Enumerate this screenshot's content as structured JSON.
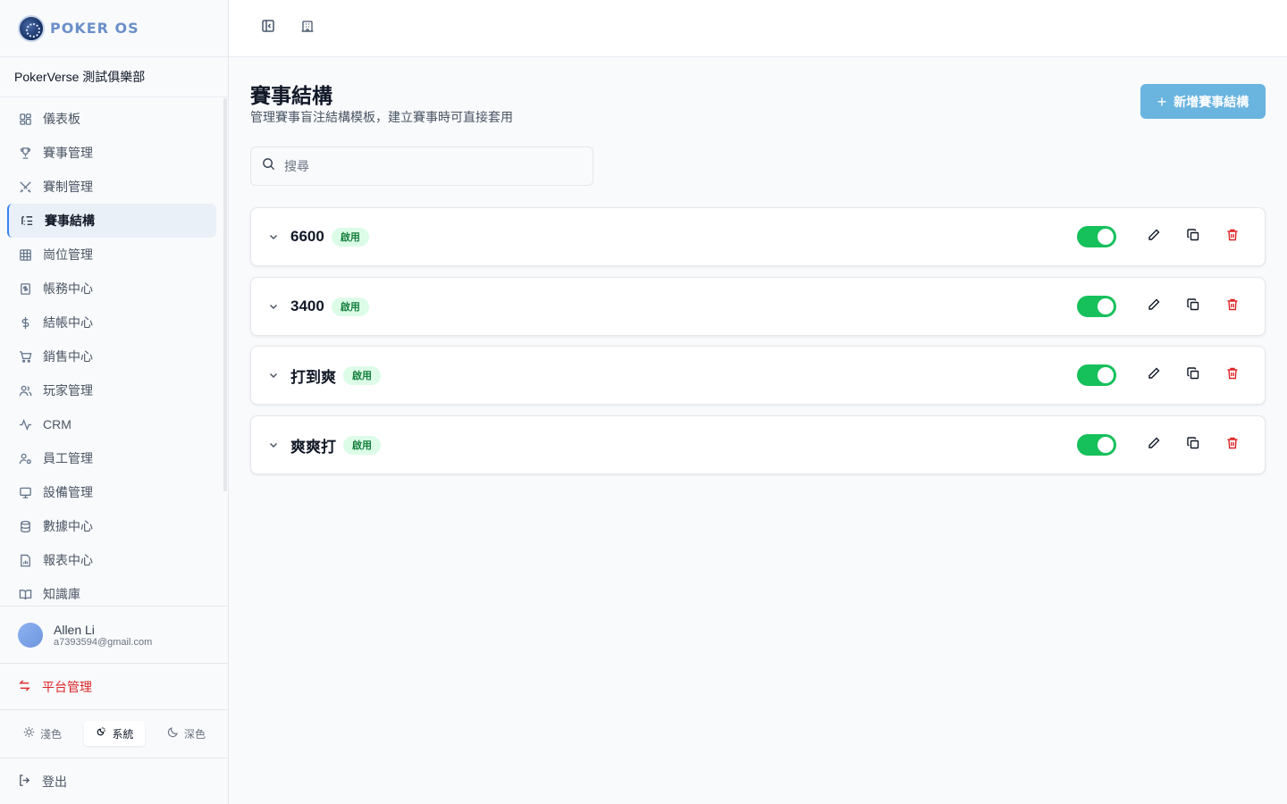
{
  "brand": {
    "name": "POKER OS"
  },
  "club": {
    "name": "PokerVerse 測試俱樂部"
  },
  "sidebar": {
    "items": [
      {
        "label": "儀表板",
        "icon": "dashboard-icon"
      },
      {
        "label": "賽事管理",
        "icon": "trophy-icon"
      },
      {
        "label": "賽制管理",
        "icon": "swords-icon"
      },
      {
        "label": "賽事結構",
        "icon": "list-tree-icon",
        "active": true
      },
      {
        "label": "崗位管理",
        "icon": "grid-icon"
      },
      {
        "label": "帳務中心",
        "icon": "receipt-icon"
      },
      {
        "label": "結帳中心",
        "icon": "dollar-icon"
      },
      {
        "label": "銷售中心",
        "icon": "cart-icon"
      },
      {
        "label": "玩家管理",
        "icon": "users-icon"
      },
      {
        "label": "CRM",
        "icon": "activity-icon"
      },
      {
        "label": "員工管理",
        "icon": "user-cog-icon"
      },
      {
        "label": "設備管理",
        "icon": "monitor-icon"
      },
      {
        "label": "數據中心",
        "icon": "database-icon"
      },
      {
        "label": "報表中心",
        "icon": "file-chart-icon"
      },
      {
        "label": "知識庫",
        "icon": "book-icon"
      }
    ]
  },
  "user": {
    "name": "Allen Li",
    "email": "a7393594@gmail.com"
  },
  "platform": {
    "label": "平台管理"
  },
  "theme": {
    "light": "淺色",
    "system": "系統",
    "dark": "深色",
    "selected": "system"
  },
  "logout": {
    "label": "登出"
  },
  "page": {
    "title": "賽事結構",
    "subtitle": "管理賽事盲注結構模板，建立賽事時可直接套用",
    "add_label": "新增賽事結構"
  },
  "search": {
    "placeholder": "搜尋",
    "value": ""
  },
  "structures": [
    {
      "name": "6600",
      "status": "啟用",
      "enabled": true
    },
    {
      "name": "3400",
      "status": "啟用",
      "enabled": true
    },
    {
      "name": "打到爽",
      "status": "啟用",
      "enabled": true
    },
    {
      "name": "爽爽打",
      "status": "啟用",
      "enabled": true
    }
  ],
  "colors": {
    "accent": "#6ab4e0",
    "toggle_on": "#16c05b",
    "danger": "#dc2626",
    "badge_bg": "#dcfce7",
    "badge_text": "#15803d"
  }
}
